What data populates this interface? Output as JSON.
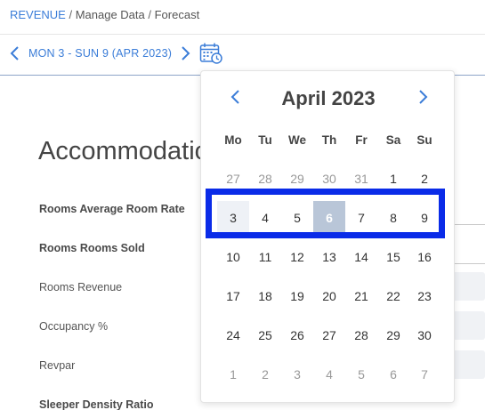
{
  "breadcrumb": {
    "root": "REVENUE",
    "sep1": " / ",
    "middle": "Manage Data",
    "sep2": " / ",
    "current": "Forecast"
  },
  "week_nav": {
    "label": "MON 3 - SUN 9 (APR 2023)",
    "prev_icon": "chevron-left-icon",
    "next_icon": "chevron-right-icon",
    "calendar_icon": "calendar-clock-icon"
  },
  "section": {
    "title": "Accommodation"
  },
  "metrics": [
    {
      "label": "Rooms Average Room Rate",
      "bold": true
    },
    {
      "label": "Rooms Rooms Sold",
      "bold": true
    },
    {
      "label": "Rooms Revenue",
      "bold": false
    },
    {
      "label": "Occupancy %",
      "bold": false
    },
    {
      "label": "Revpar",
      "bold": false
    },
    {
      "label": "Sleeper Density Ratio",
      "bold": true
    }
  ],
  "calendar": {
    "month_title": "April 2023",
    "weekdays": [
      "Mo",
      "Tu",
      "We",
      "Th",
      "Fr",
      "Sa",
      "Su"
    ],
    "weeks": [
      [
        "27",
        "28",
        "29",
        "30",
        "31",
        "1",
        "2"
      ],
      [
        "3",
        "4",
        "5",
        "6",
        "7",
        "8",
        "9"
      ],
      [
        "10",
        "11",
        "12",
        "13",
        "14",
        "15",
        "16"
      ],
      [
        "17",
        "18",
        "19",
        "20",
        "21",
        "22",
        "23"
      ],
      [
        "24",
        "25",
        "26",
        "27",
        "28",
        "29",
        "30"
      ],
      [
        "1",
        "2",
        "3",
        "4",
        "5",
        "6",
        "7"
      ]
    ],
    "muted_cells": [
      [
        0,
        0
      ],
      [
        0,
        1
      ],
      [
        0,
        2
      ],
      [
        0,
        3
      ],
      [
        0,
        4
      ],
      [
        5,
        0
      ],
      [
        5,
        1
      ],
      [
        5,
        2
      ],
      [
        5,
        3
      ],
      [
        5,
        4
      ],
      [
        5,
        5
      ],
      [
        5,
        6
      ]
    ],
    "selected_week_index": 1,
    "today_cell": [
      1,
      3
    ],
    "colors": {
      "accent": "#3b7dd8",
      "highlight_border": "#0a2be8",
      "today_bg": "#b9c6d8"
    }
  }
}
